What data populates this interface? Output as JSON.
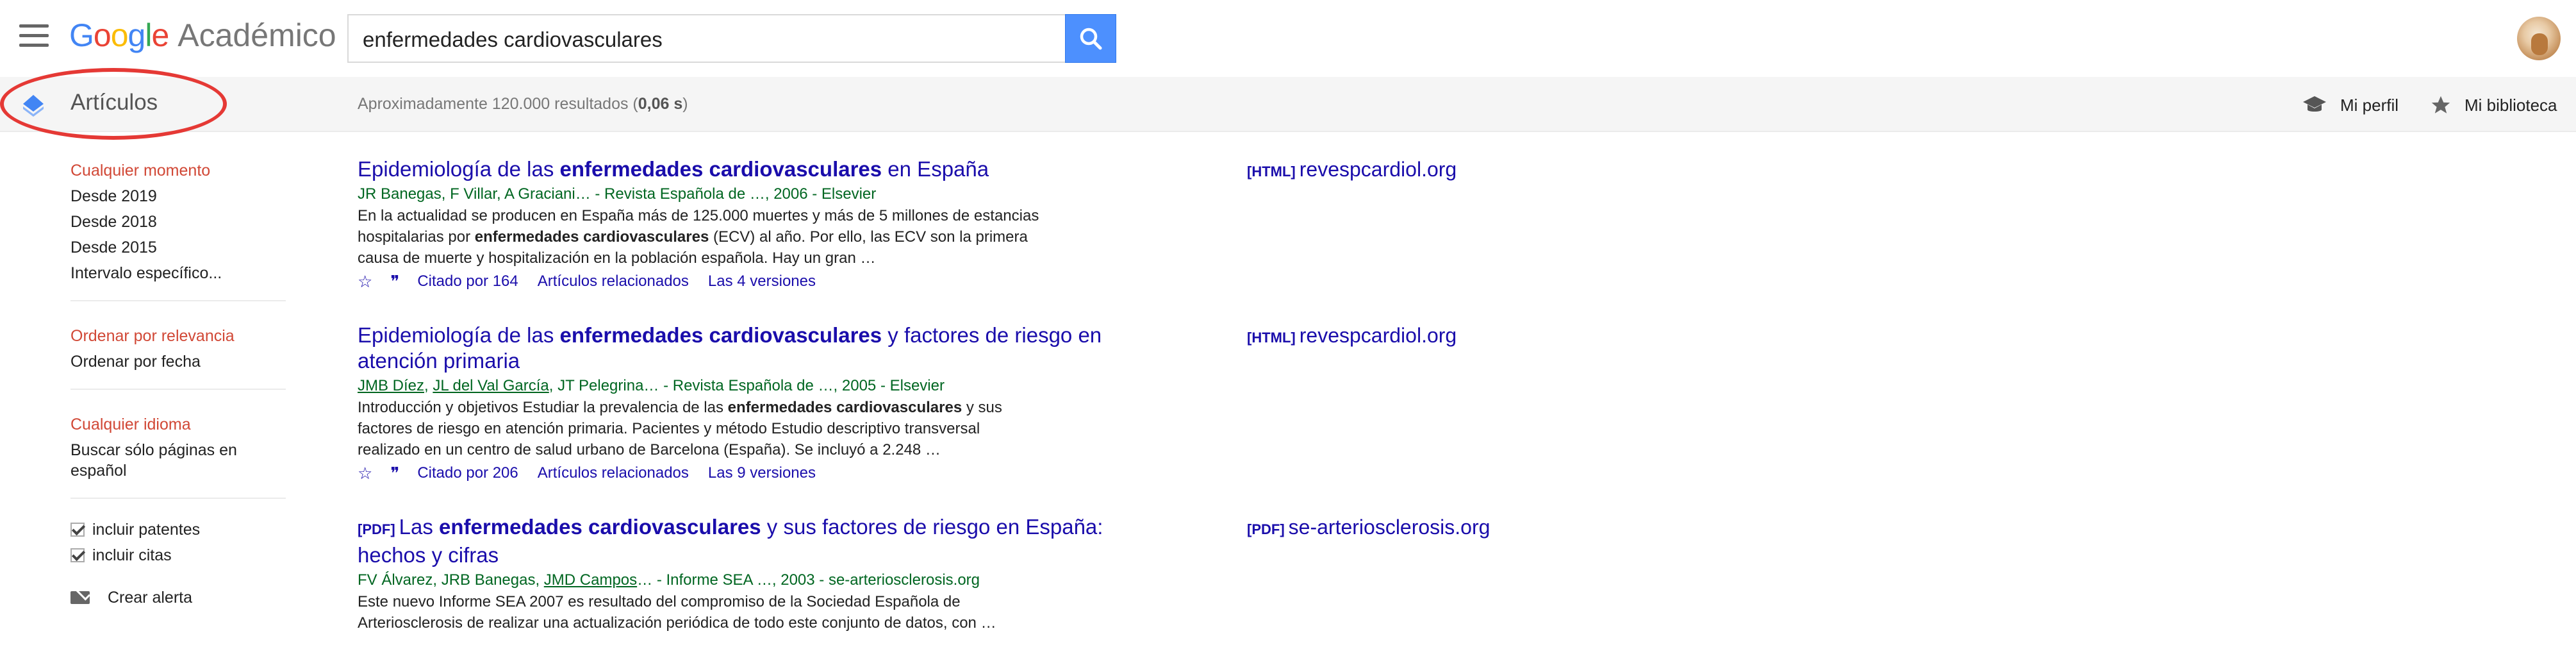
{
  "header": {
    "logo_word": "Google",
    "product": "Académico",
    "search_value": "enfermedades cardiovasculares"
  },
  "subheader": {
    "section": "Artículos",
    "stats_prefix": "Aproximadamente 120.000 resultados (",
    "stats_time": "0,06 s",
    "stats_suffix": ")",
    "profile": "Mi perfil",
    "library": "Mi biblioteca"
  },
  "sidebar": {
    "time": [
      "Cualquier momento",
      "Desde 2019",
      "Desde 2018",
      "Desde 2015",
      "Intervalo específico..."
    ],
    "sort": [
      "Ordenar por relevancia",
      "Ordenar por fecha"
    ],
    "lang": [
      "Cualquier idioma",
      "Buscar sólo páginas en español"
    ],
    "checks": [
      "incluir patentes",
      "incluir citas"
    ],
    "alert": "Crear alerta"
  },
  "results": [
    {
      "tag": "",
      "title_pre": "Epidemiología de las ",
      "title_bold": "enfermedades cardiovasculares",
      "title_post": " en España",
      "authors": "JR Banegas, F Villar, A Graciani… - Revista Española de …, 2006 - Elsevier",
      "snippet_pre": "En la actualidad se producen en España más de 125.000 muertes y más de 5 millones de estancias hospitalarias por ",
      "snippet_bold": "enfermedades cardiovasculares",
      "snippet_post": " (ECV) al año. Por ello, las ECV son la primera causa de muerte y hospitalización en la población española. Hay un gran …",
      "cited": "Citado por 164",
      "related": "Artículos relacionados",
      "versions": "Las 4 versiones",
      "side_tag": "[HTML]",
      "side_domain": "revespcardiol.org"
    },
    {
      "tag": "",
      "title_pre": "Epidemiología de las ",
      "title_bold": "enfermedades cardiovasculares",
      "title_post": " y factores de riesgo en atención primaria",
      "authors_links": [
        "JMB Díez",
        "JL del Val García"
      ],
      "authors_rest": ", JT Pelegrina… - Revista Española de …, 2005 - Elsevier",
      "snippet_pre": "Introducción y objetivos Estudiar la prevalencia de las ",
      "snippet_bold": "enfermedades cardiovasculares",
      "snippet_post": " y sus factores de riesgo en atención primaria. Pacientes y método Estudio descriptivo transversal realizado en un centro de salud urbano de Barcelona (España). Se incluyó a 2.248 …",
      "cited": "Citado por 206",
      "related": "Artículos relacionados",
      "versions": "Las 9 versiones",
      "side_tag": "[HTML]",
      "side_domain": "revespcardiol.org"
    },
    {
      "tag": "[PDF]",
      "title_pre": "Las ",
      "title_bold": "enfermedades cardiovasculares",
      "title_post": " y sus factores de riesgo en España: hechos y cifras",
      "authors_a": "FV Álvarez, JRB Banegas, ",
      "authors_link": "JMD Campos",
      "authors_b": "… - Informe SEA …, 2003 - se-arteriosclerosis.org",
      "snippet": "Este nuevo Informe SEA 2007 es resultado del compromiso de la Sociedad Española de Arteriosclerosis de realizar una actualización periódica de todo este conjunto de datos, con …",
      "side_tag": "[PDF]",
      "side_domain": "se-arteriosclerosis.org"
    }
  ]
}
